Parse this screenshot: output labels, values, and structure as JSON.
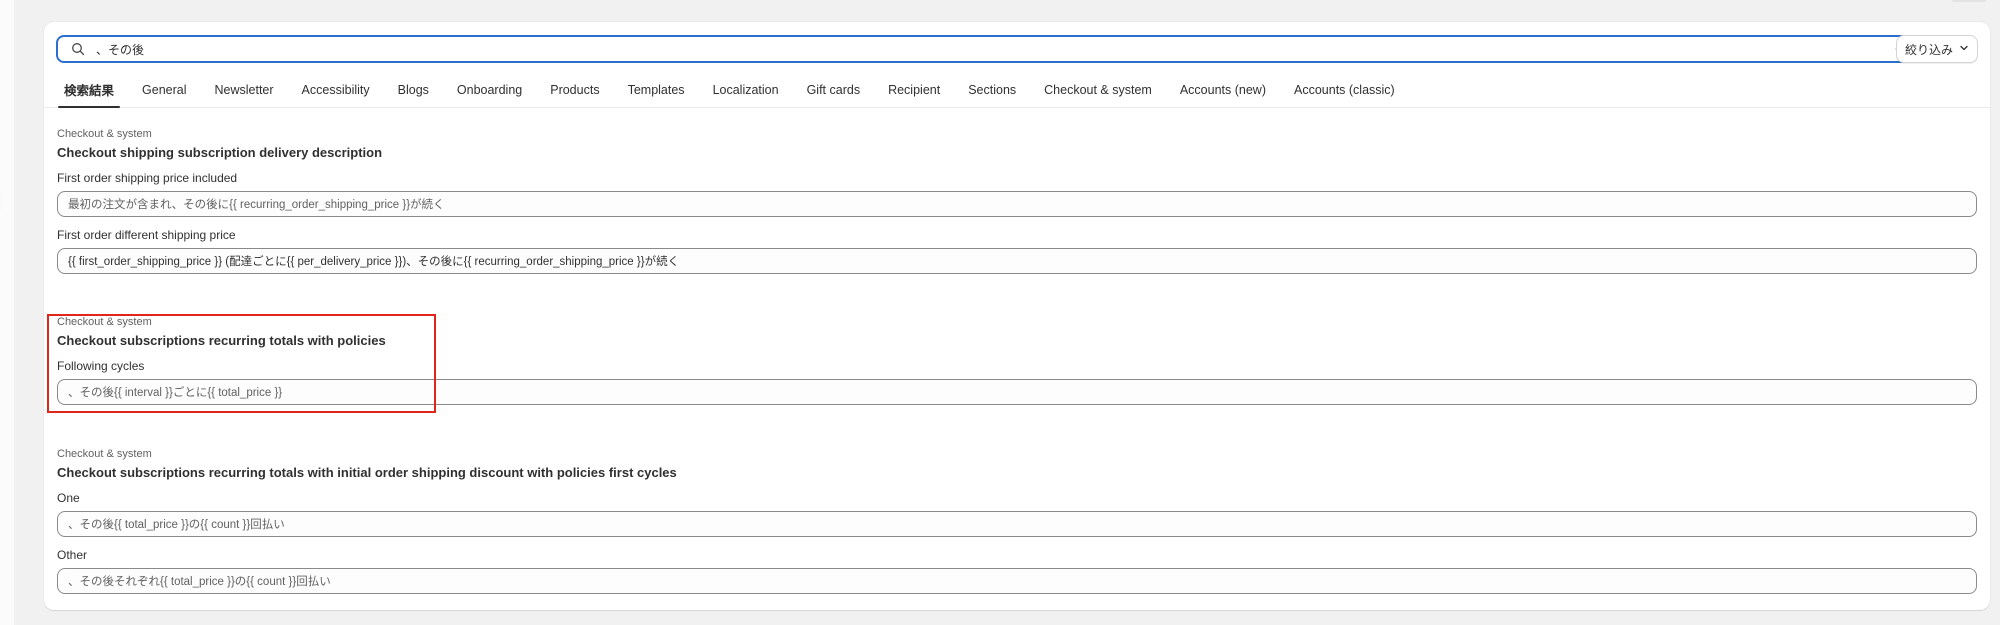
{
  "search": {
    "value": "、その後",
    "clear_icon": "clear-circle-icon"
  },
  "filter": {
    "label": "絞り込み"
  },
  "tabs": [
    {
      "label": "検索結果",
      "active": true
    },
    {
      "label": "General"
    },
    {
      "label": "Newsletter"
    },
    {
      "label": "Accessibility"
    },
    {
      "label": "Blogs"
    },
    {
      "label": "Onboarding"
    },
    {
      "label": "Products"
    },
    {
      "label": "Templates"
    },
    {
      "label": "Localization"
    },
    {
      "label": "Gift cards"
    },
    {
      "label": "Recipient"
    },
    {
      "label": "Sections"
    },
    {
      "label": "Checkout & system"
    },
    {
      "label": "Accounts (new)"
    },
    {
      "label": "Accounts (classic)"
    }
  ],
  "results": [
    {
      "category": "Checkout & system",
      "title": "Checkout shipping subscription delivery description",
      "fields": [
        {
          "label": "First order shipping price included",
          "value": "最初の注文が含まれ、その後に{{ recurring_order_shipping_price }}が続く"
        },
        {
          "label": "First order different shipping price",
          "value": "{{ first_order_shipping_price }} (配達ごとに{{ per_delivery_price }})、その後に{{ recurring_order_shipping_price }}が続く"
        }
      ]
    },
    {
      "category": "Checkout & system",
      "title": "Checkout subscriptions recurring totals with policies",
      "fields": [
        {
          "label": "Following cycles",
          "value": "、その後{{ interval }}ごとに{{ total_price }}"
        }
      ]
    },
    {
      "category": "Checkout & system",
      "title": "Checkout subscriptions recurring totals with initial order shipping discount with policies first cycles",
      "fields": [
        {
          "label": "One",
          "value": "、その後{{ total_price }}の{{ count }}回払い"
        },
        {
          "label": "Other",
          "value": "、その後それぞれ{{ total_price }}の{{ count }}回払い"
        }
      ]
    }
  ],
  "colors": {
    "accent": "#2c6ecb",
    "highlight": "#e0261b"
  }
}
